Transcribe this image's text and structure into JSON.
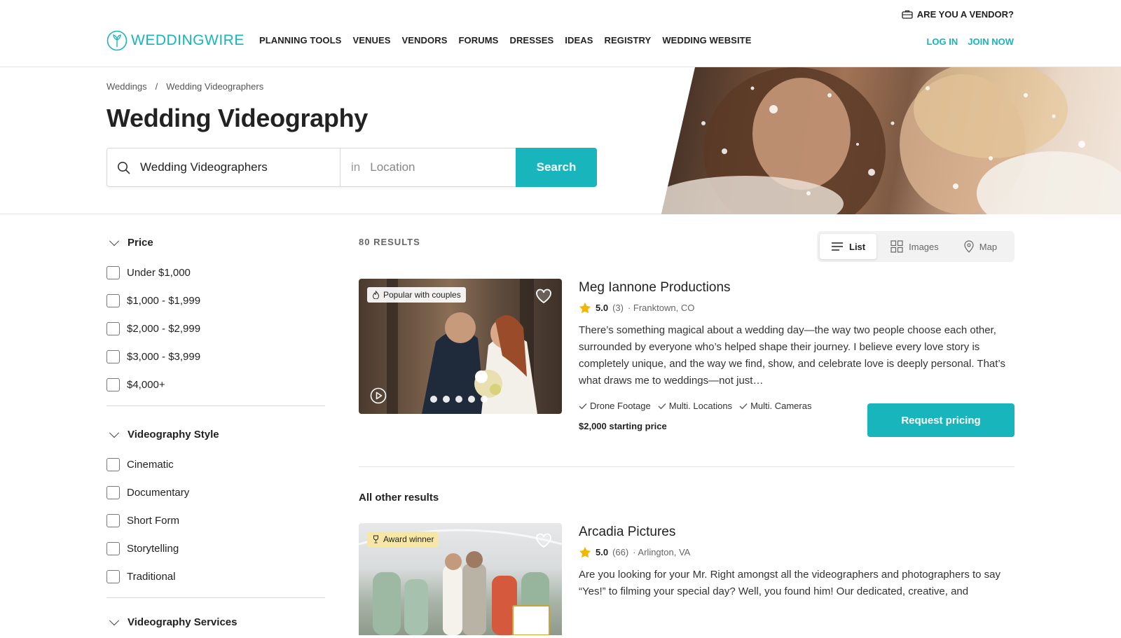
{
  "header": {
    "vendor_link": "ARE YOU A VENDOR?",
    "logo": "WEDDINGWIRE",
    "nav": [
      "PLANNING TOOLS",
      "VENUES",
      "VENDORS",
      "FORUMS",
      "DRESSES",
      "IDEAS",
      "REGISTRY",
      "WEDDING WEBSITE"
    ],
    "login": "LOG IN",
    "join": "JOIN NOW",
    "brand_color": "#19b5bc"
  },
  "hero": {
    "breadcrumb": [
      "Weddings",
      "/",
      "Wedding Videographers"
    ],
    "title": "Wedding Videography",
    "search_value": "Wedding Videographers",
    "location_in": "in",
    "location_placeholder": "Location",
    "search_button": "Search"
  },
  "filters": [
    {
      "title": "Price",
      "options": [
        "Under $1,000",
        "$1,000 - $1,999",
        "$2,000 - $2,999",
        "$3,000 - $3,999",
        "$4,000+"
      ]
    },
    {
      "title": "Videography Style",
      "options": [
        "Cinematic",
        "Documentary",
        "Short Form",
        "Storytelling",
        "Traditional"
      ]
    },
    {
      "title": "Videography Services",
      "options": []
    }
  ],
  "results": {
    "count": "80 RESULTS",
    "views": [
      "List",
      "Images",
      "Map"
    ],
    "other_label": "All other results",
    "cards": [
      {
        "badge": "Popular with couples",
        "title": "Meg Iannone Productions",
        "rating": "5.0",
        "reviews": "(3)",
        "location": "· Franktown, CO",
        "description": "There’s something magical about a wedding day—the way two people choose each other, surrounded by everyone who’s helped shape their journey. I believe every love story is completely unique, and the way we find, show, and celebrate love is deeply personal. That’s what draws me to weddings—not just…",
        "features": [
          "Drone Footage",
          "Multi. Locations",
          "Multi. Cameras"
        ],
        "price": "$2,000 starting price",
        "cta": "Request pricing"
      },
      {
        "badge": "Award winner",
        "title": "Arcadia Pictures",
        "rating": "5.0",
        "reviews": "(66)",
        "location": "· Arlington, VA",
        "description": "Are you looking for your Mr. Right amongst all the videographers and photographers to say “Yes!” to filming your special day? Well, you found him! Our dedicated, creative, and passionate crew members have been working in the industry for years. We will capture the magic of your day, edit the footage..."
      }
    ]
  }
}
